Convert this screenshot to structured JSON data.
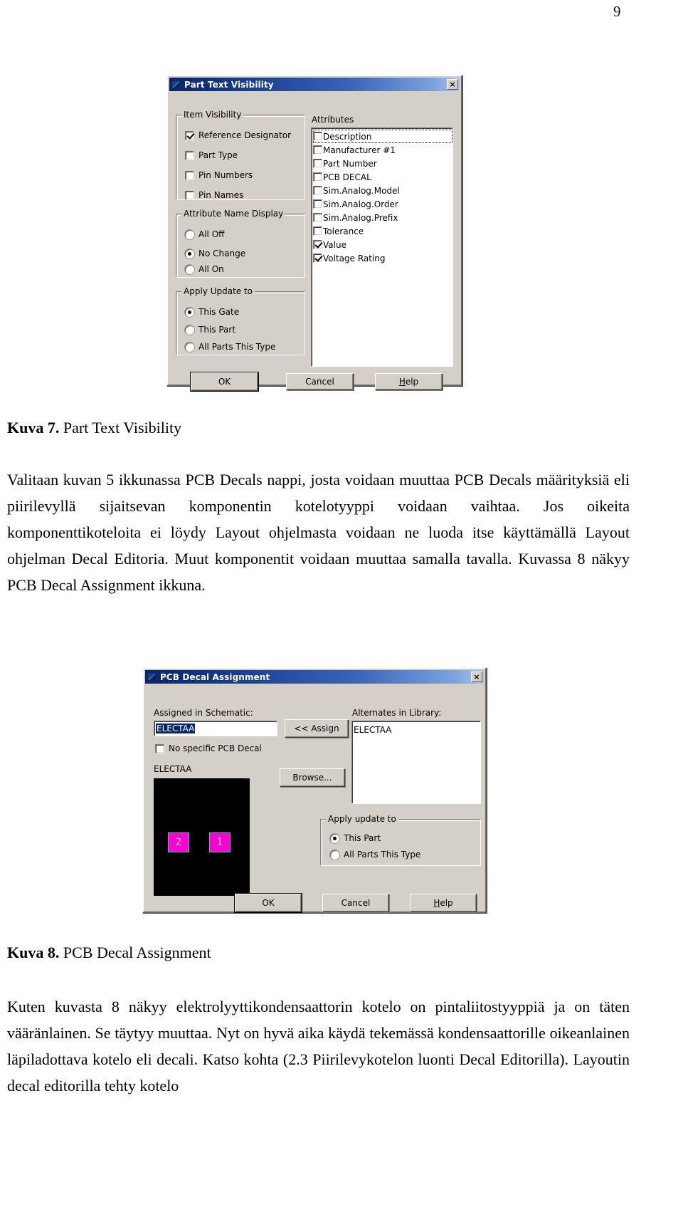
{
  "page": {
    "number": "9"
  },
  "dialog1": {
    "title": "Part Text Visibility",
    "close_label": "×",
    "groups": {
      "item_visibility": {
        "label": "Item Visibility",
        "items": [
          {
            "label": "Reference Designator",
            "checked": true
          },
          {
            "label": "Part Type",
            "checked": false
          },
          {
            "label": "Pin Numbers",
            "checked": false
          },
          {
            "label": "Pin Names",
            "checked": false
          }
        ]
      },
      "attribute_name_display": {
        "label": "Attribute Name Display",
        "items": [
          {
            "label": "All Off",
            "selected": false
          },
          {
            "label": "No Change",
            "selected": true
          },
          {
            "label": "All On",
            "selected": false
          }
        ]
      },
      "apply_update_to": {
        "label": "Apply Update to",
        "items": [
          {
            "label": "This Gate",
            "selected": true
          },
          {
            "label": "This Part",
            "selected": false
          },
          {
            "label": "All Parts This Type",
            "selected": false
          }
        ]
      },
      "attributes": {
        "label": "Attributes",
        "items": [
          {
            "label": "Description",
            "checked": false,
            "focused": true
          },
          {
            "label": "Manufacturer #1",
            "checked": false,
            "focused": false
          },
          {
            "label": "Part Number",
            "checked": false,
            "focused": false
          },
          {
            "label": "PCB DECAL",
            "checked": false,
            "focused": false
          },
          {
            "label": "Sim.Analog.Model",
            "checked": false,
            "focused": false
          },
          {
            "label": "Sim.Analog.Order",
            "checked": false,
            "focused": false
          },
          {
            "label": "Sim.Analog.Prefix",
            "checked": false,
            "focused": false
          },
          {
            "label": "Tolerance",
            "checked": false,
            "focused": false
          },
          {
            "label": "Value",
            "checked": true,
            "focused": false
          },
          {
            "label": "Voltage Rating",
            "checked": true,
            "focused": false
          }
        ]
      }
    },
    "buttons": {
      "ok": "OK",
      "cancel": "Cancel",
      "help": "Help",
      "help_mnemonic": "H"
    }
  },
  "caption1": {
    "figure": "Kuva 7.",
    "text": "Part Text Visibility"
  },
  "paragraph1": "Valitaan kuvan 5 ikkunassa PCB Decals nappi, josta voidaan muuttaa PCB Decals määrityksiä eli piirilevyllä sijaitsevan komponentin kotelotyyppi voidaan vaihtaa. Jos oikeita komponenttikoteloita ei löydy Layout ohjelmasta voidaan ne luoda itse käyttämällä Layout ohjelman Decal Editoria. Muut komponentit voidaan muuttaa samalla tavalla. Kuvassa 8 näkyy PCB Decal Assignment ikkuna.",
  "dialog2": {
    "title": "PCB Decal Assignment",
    "close_label": "×",
    "assigned_label": "Assigned in Schematic:",
    "assigned_value": "ELECTAA",
    "assign_button": "<< Assign",
    "no_specific": {
      "label": "No specific PCB Decal",
      "checked": false
    },
    "decal_name": "ELECTAA",
    "browse_button": "Browse...",
    "alternates_label": "Alternates in Library:",
    "alternates_items": [
      "ELECTAA"
    ],
    "apply_update_to": {
      "label": "Apply update to",
      "items": [
        {
          "label": "This Part",
          "selected": true
        },
        {
          "label": "All Parts This Type",
          "selected": false
        }
      ]
    },
    "preview_pads": [
      {
        "number": "2"
      },
      {
        "number": "1"
      }
    ],
    "buttons": {
      "ok": "OK",
      "cancel": "Cancel",
      "help": "Help",
      "help_mnemonic": "H"
    }
  },
  "caption2": {
    "figure": "Kuva 8.",
    "text": "PCB Decal Assignment"
  },
  "paragraph2": "Kuten kuvasta 8 näkyy elektrolyyttikondensaattorin kotelo on pintaliitostyyppiä ja on täten vääränlainen. Se täytyy muuttaa. Nyt on hyvä aika käydä tekemässä kondensaattorille oikeanlainen läpiladottava kotelo eli decali. Katso kohta (2.3 Piirilevykotelon luonti Decal Editorilla). Layoutin decal editorilla tehty kotelo"
}
